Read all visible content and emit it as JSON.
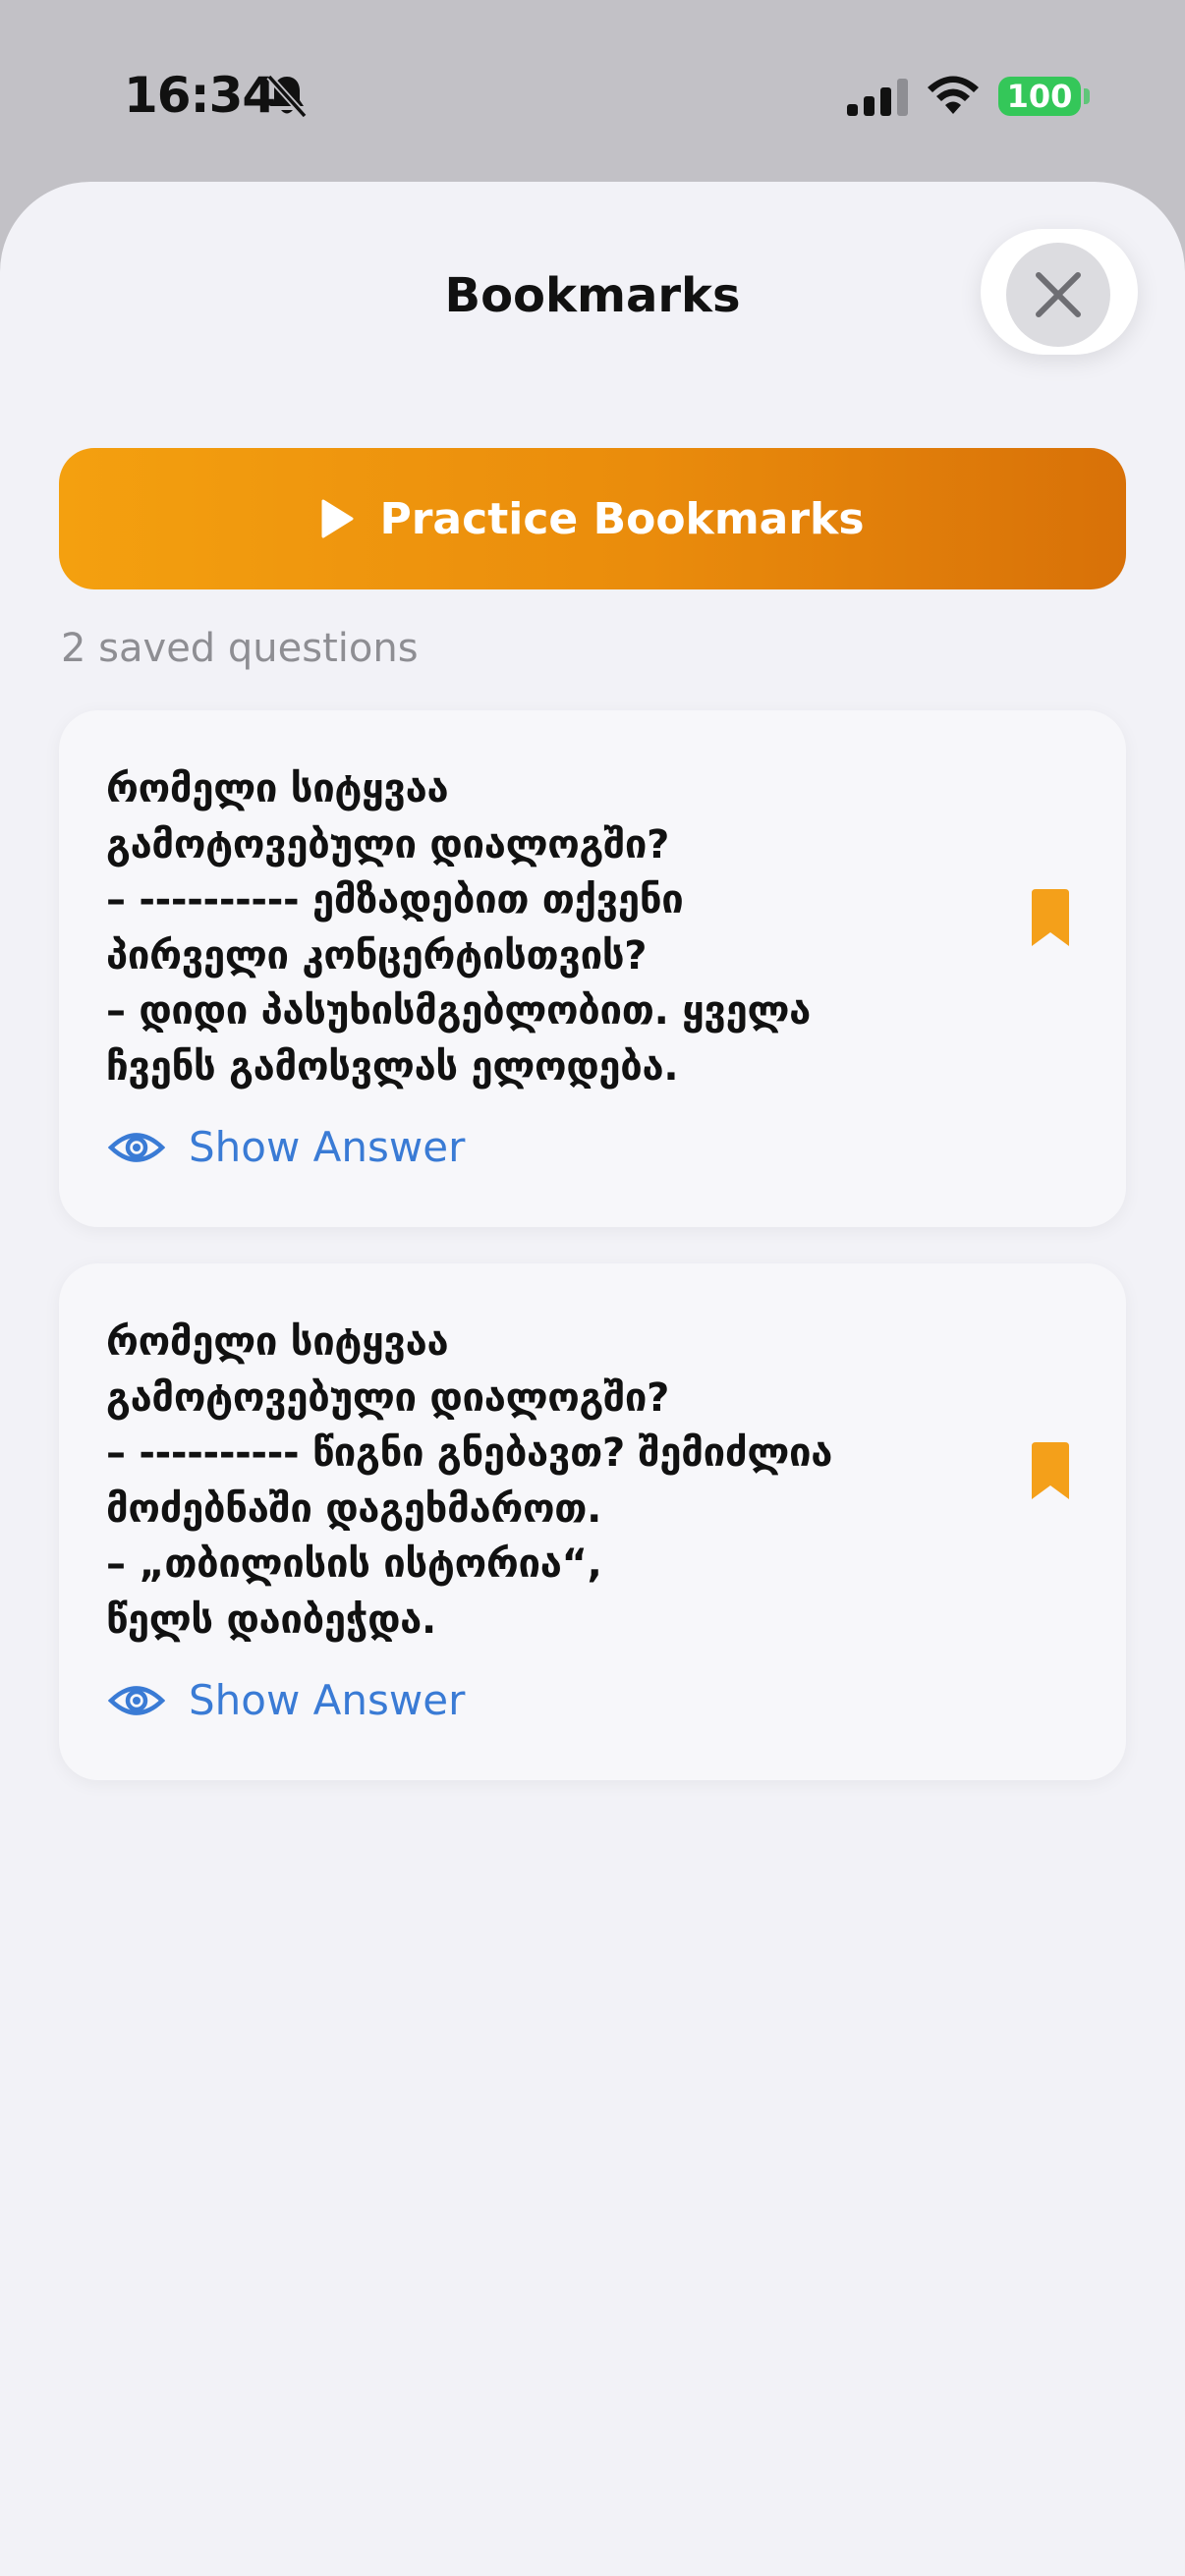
{
  "status_bar": {
    "time": "16:34",
    "battery": "100"
  },
  "sheet": {
    "title": "Bookmarks",
    "practice_label": "Practice Bookmarks",
    "saved_count": "2 saved questions"
  },
  "cards": [
    {
      "question": "რომელი სიტყვაა\nგამოტოვებული დიალოგში?\n– ---------- ემზადებით თქვენი\nპირველი კონცერტისთვის?\n– დიდი პასუხისმგებლობით. ყველა\nჩვენს გამოსვლას ელოდება.",
      "show_answer_label": "Show Answer"
    },
    {
      "question": "რომელი სიტყვაა\nგამოტოვებული დიალოგში?\n– ---------- წიგნი გნებავთ? შემიძლია\nმოძებნაში დაგეხმაროთ.\n– „თბილისის ისტორია“,\nწელს დაიბეჭდა.",
      "show_answer_label": "Show Answer"
    }
  ],
  "colors": {
    "accent_orange": "#f4a00f",
    "link_blue": "#3a7bd5",
    "battery_green": "#34c759"
  },
  "icons": {
    "close": "close-icon",
    "play": "play-icon",
    "bookmark": "bookmark-icon",
    "eye": "eye-icon"
  }
}
